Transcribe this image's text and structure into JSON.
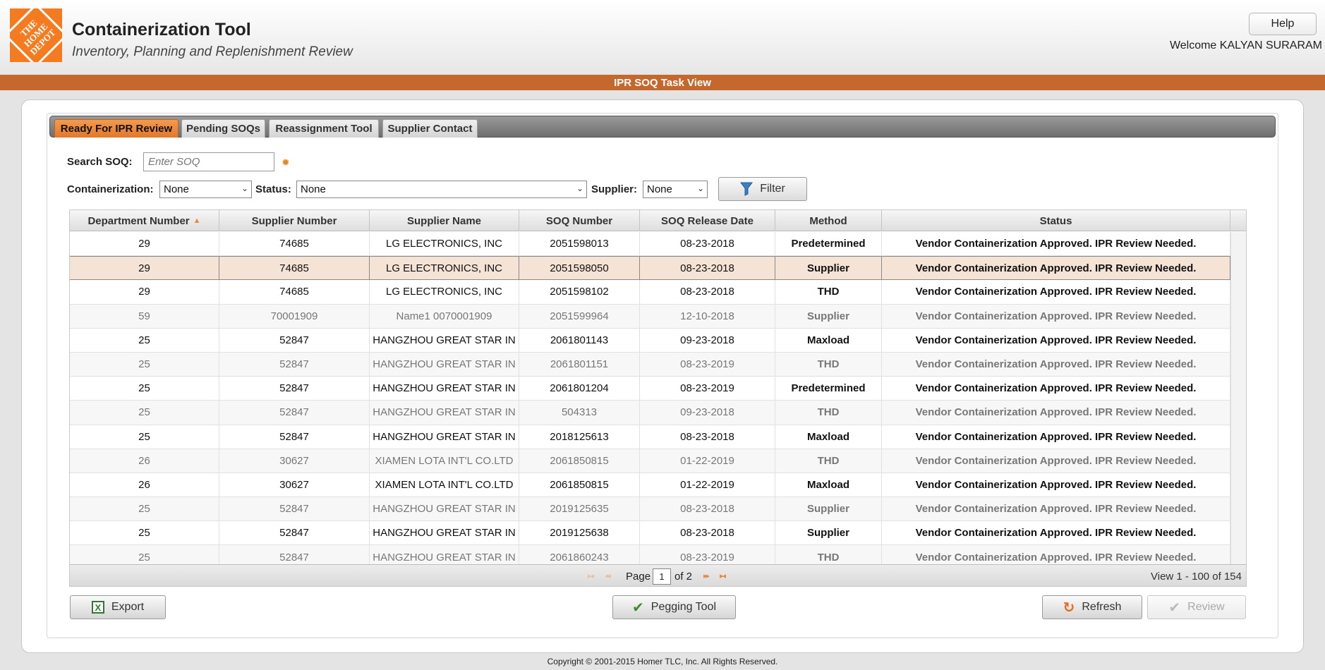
{
  "header": {
    "logo_text": "THE\nHOME\nDEPOT",
    "title": "Containerization Tool",
    "subtitle": "Inventory, Planning and Replenishment Review",
    "help_label": "Help",
    "welcome": "Welcome KALYAN SURARAM"
  },
  "banner": {
    "title": "IPR SOQ Task View"
  },
  "tabs": [
    {
      "label": "Ready For IPR Review",
      "active": true
    },
    {
      "label": "Pending SOQs",
      "active": false
    },
    {
      "label": "Reassignment Tool",
      "active": false
    },
    {
      "label": "Supplier Contact",
      "active": false
    }
  ],
  "search": {
    "label": "Search SOQ:",
    "placeholder": "Enter SOQ",
    "value": ""
  },
  "filters": {
    "containerization_label": "Containerization:",
    "containerization_value": "None",
    "status_label": "Status:",
    "status_value": "None",
    "supplier_label": "Supplier:",
    "supplier_value": "None",
    "filter_button": "Filter"
  },
  "table": {
    "columns": [
      "Department Number",
      "Supplier Number",
      "Supplier Name",
      "SOQ Number",
      "SOQ Release Date",
      "Method",
      "Status"
    ],
    "sorted_column": "Department Number",
    "sort_direction": "ascending",
    "rows": [
      [
        "29",
        "74685",
        "LG ELECTRONICS, INC",
        "2051598013",
        "08-23-2018",
        "Predetermined",
        "Vendor Containerization Approved. IPR Review Needed."
      ],
      [
        "29",
        "74685",
        "LG ELECTRONICS, INC",
        "2051598050",
        "08-23-2018",
        "Supplier",
        "Vendor Containerization Approved. IPR Review Needed."
      ],
      [
        "29",
        "74685",
        "LG ELECTRONICS, INC",
        "2051598102",
        "08-23-2018",
        "THD",
        "Vendor Containerization Approved. IPR Review Needed."
      ],
      [
        "59",
        "70001909",
        "Name1 0070001909",
        "2051599964",
        "12-10-2018",
        "Supplier",
        "Vendor Containerization Approved. IPR Review Needed."
      ],
      [
        "25",
        "52847",
        "HANGZHOU GREAT STAR IN",
        "2061801143",
        "09-23-2018",
        "Maxload",
        "Vendor Containerization Approved. IPR Review Needed."
      ],
      [
        "25",
        "52847",
        "HANGZHOU GREAT STAR IN",
        "2061801151",
        "08-23-2019",
        "THD",
        "Vendor Containerization Approved. IPR Review Needed."
      ],
      [
        "25",
        "52847",
        "HANGZHOU GREAT STAR IN",
        "2061801204",
        "08-23-2019",
        "Predetermined",
        "Vendor Containerization Approved. IPR Review Needed."
      ],
      [
        "25",
        "52847",
        "HANGZHOU GREAT STAR IN",
        "504313",
        "09-23-2018",
        "THD",
        "Vendor Containerization Approved. IPR Review Needed."
      ],
      [
        "25",
        "52847",
        "HANGZHOU GREAT STAR IN",
        "2018125613",
        "08-23-2018",
        "Maxload",
        "Vendor Containerization Approved. IPR Review Needed."
      ],
      [
        "26",
        "30627",
        "XIAMEN LOTA INT'L CO.LTD",
        "2061850815",
        "01-22-2019",
        "THD",
        "Vendor Containerization Approved. IPR Review Needed."
      ],
      [
        "26",
        "30627",
        "XIAMEN LOTA INT'L CO.LTD",
        "2061850815",
        "01-22-2019",
        "Maxload",
        "Vendor Containerization Approved. IPR Review Needed."
      ],
      [
        "25",
        "52847",
        "HANGZHOU GREAT STAR IN",
        "2019125635",
        "08-23-2018",
        "Supplier",
        "Vendor Containerization Approved. IPR Review Needed."
      ],
      [
        "25",
        "52847",
        "HANGZHOU GREAT STAR IN",
        "2019125638",
        "08-23-2018",
        "Supplier",
        "Vendor Containerization Approved. IPR Review Needed."
      ],
      [
        "25",
        "52847",
        "HANGZHOU GREAT STAR IN",
        "2061860243",
        "08-23-2019",
        "THD",
        "Vendor Containerization Approved. IPR Review Needed."
      ]
    ],
    "selected_row": 1,
    "dim_rows": [
      3,
      5,
      7,
      9,
      11,
      13
    ]
  },
  "pager": {
    "page_label": "Page",
    "page_value": "1",
    "of_label": "of 2",
    "view_count": "View 1 - 100 of 154"
  },
  "buttons": {
    "export": "Export",
    "pegging": "Pegging Tool",
    "refresh": "Refresh",
    "review": "Review"
  },
  "footer": {
    "copyright": "Copyright © 2001-2015 Homer TLC, Inc. All Rights Reserved."
  },
  "colors": {
    "brand_orange": "#f47b20",
    "banner": "#c5682d",
    "selected_row": "#f5e3d6"
  }
}
